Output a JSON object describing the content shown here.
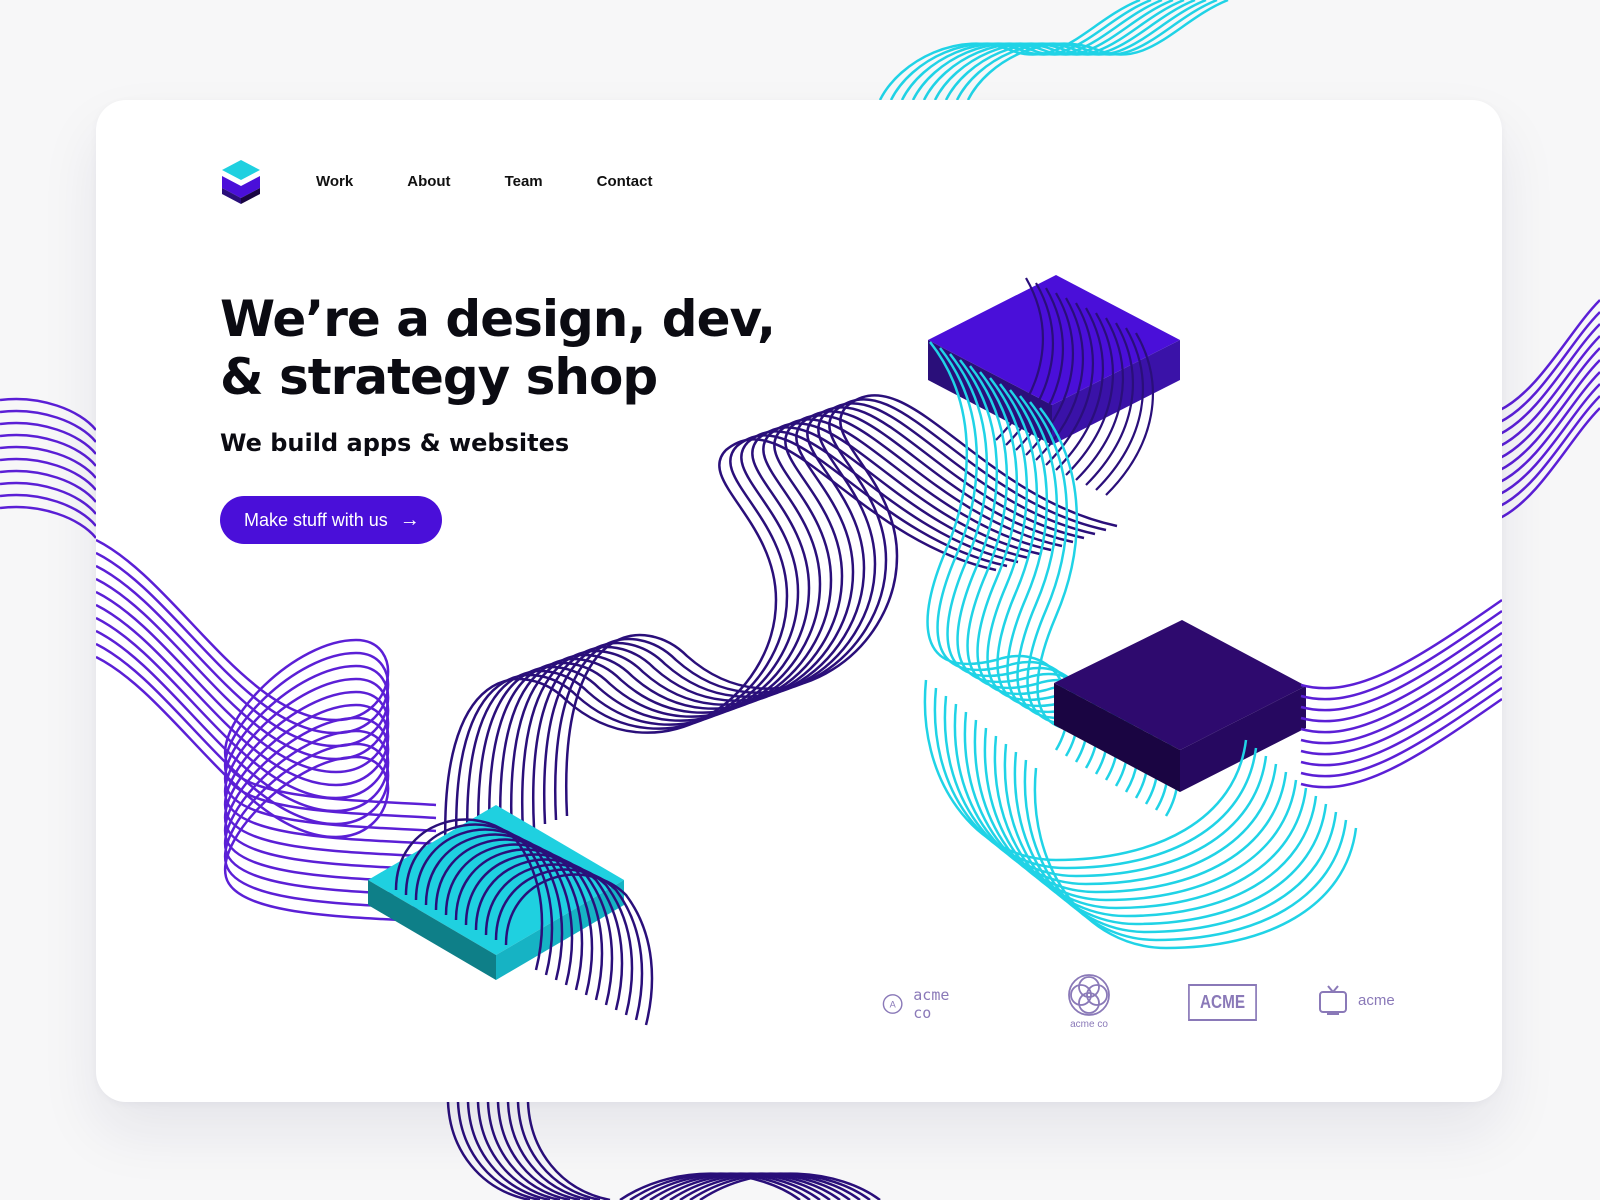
{
  "brand": {
    "logo_icon": "stacked-layers-logo-icon"
  },
  "nav": {
    "items": [
      {
        "label": "Work"
      },
      {
        "label": "About"
      },
      {
        "label": "Team"
      },
      {
        "label": "Contact"
      }
    ]
  },
  "hero": {
    "title_line1": "We’re a design, dev,",
    "title_line2": "& strategy shop",
    "subtitle": "We build apps & websites",
    "cta_label": "Make stuff with us",
    "cta_icon": "arrow-right-icon"
  },
  "clients": [
    {
      "icon": "circle-a-icon",
      "label": "acme co"
    },
    {
      "icon": "flower-rings-icon",
      "label": "acme co"
    },
    {
      "icon": "boxed-wordmark",
      "label": "ACME"
    },
    {
      "icon": "tv-icon",
      "label": "acme"
    }
  ],
  "colors": {
    "primary": "#4a0fd9",
    "violet_line": "#5b1fd6",
    "deep_purple": "#2a0f7a",
    "cyan": "#20d3e6",
    "ink": "#0b0b12",
    "muted": "#8a79b8"
  }
}
